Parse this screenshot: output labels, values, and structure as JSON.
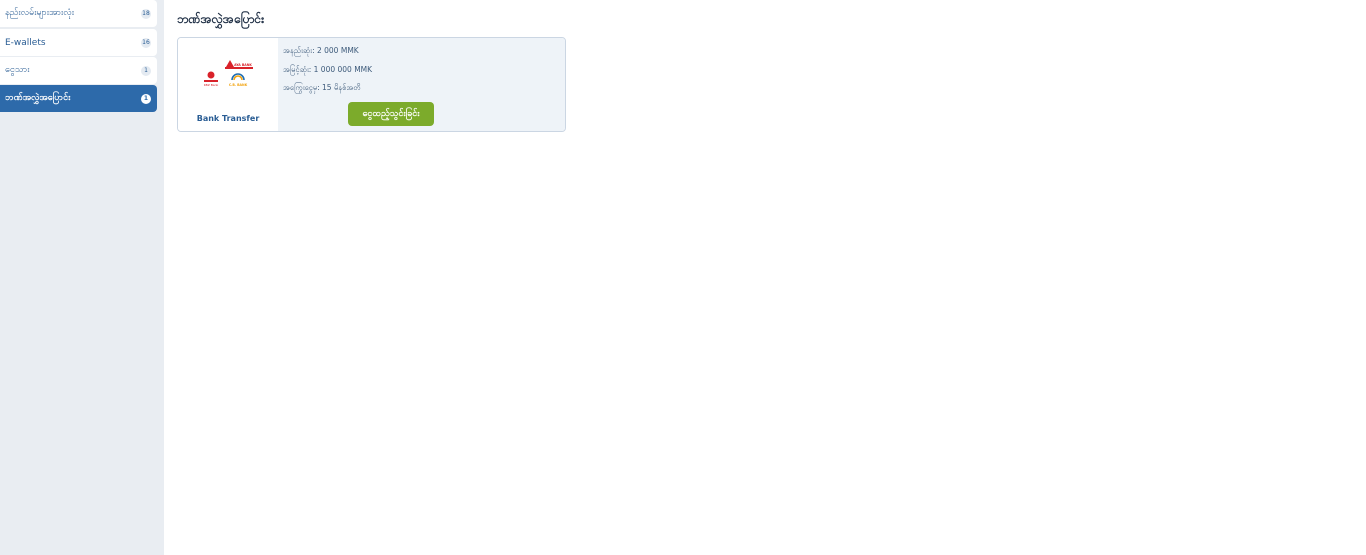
{
  "sidebar": {
    "items": [
      {
        "label": "နည်းလမ်းများအားလုံး",
        "count": "18"
      },
      {
        "label": "E-wallets",
        "count": "16"
      },
      {
        "label": "ငွေသား",
        "count": "1"
      },
      {
        "label": "ဘဏ်အလွှဲအပြောင်း",
        "count": "1"
      }
    ],
    "active_index": 3
  },
  "main": {
    "title": "ဘဏ်အလွှဲအပြောင်း",
    "methods": [
      {
        "name": "Bank Transfer",
        "logo_texts": [
          "KBZ Bank",
          "AYA BANK",
          "C.B. BANK"
        ],
        "min": "အနည်းဆုံး: 2 000 MMK",
        "max": "အမြင့်ဆုံး: 1 000 000 MMK",
        "time": "အကြွေးငွေမှ: 15 မိနစ်အတိ",
        "deposit_label": "ငွေထည့်သွင်းခြင်း"
      }
    ]
  },
  "colors": {
    "sidebar_bg": "#e9edf2",
    "active_item": "#2d6aaa",
    "button_green": "#7cab2b",
    "text_blue": "#2a5d94"
  }
}
